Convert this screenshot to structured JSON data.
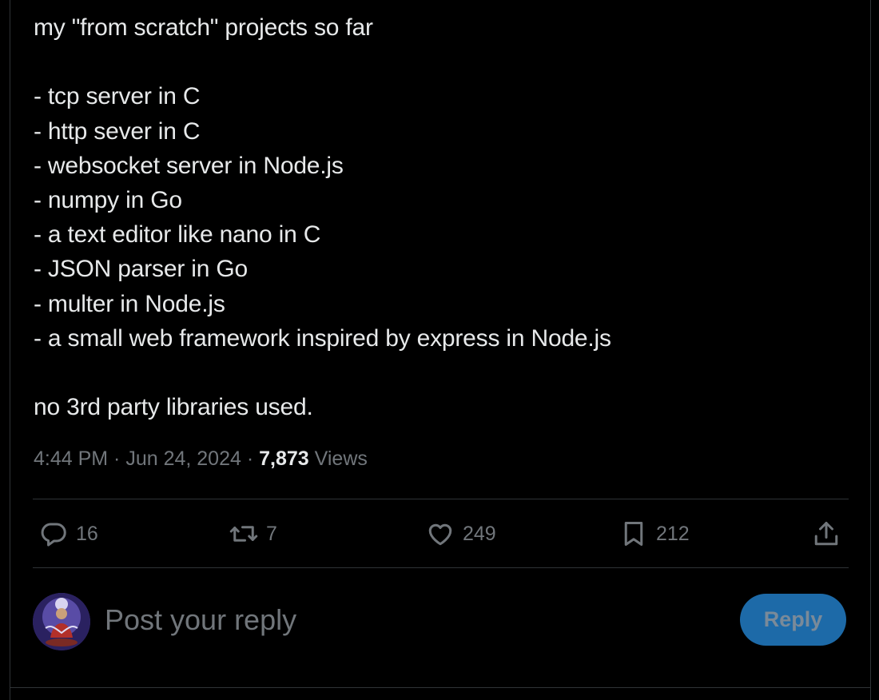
{
  "tweet": {
    "lines": [
      "my \"from scratch\" projects so far",
      "",
      "- tcp server in C",
      "- http sever in C",
      "- websocket server in Node.js",
      "- numpy in Go",
      "- a text editor like nano in C",
      "- JSON parser in Go",
      "- multer in Node.js",
      "- a small web framework inspired by express in Node.js",
      "",
      "no 3rd party libraries used."
    ],
    "time": "4:44 PM",
    "separator": " · ",
    "date": "Jun 24, 2024",
    "views_count": "7,873",
    "views_label": " Views"
  },
  "actions": {
    "reply": {
      "icon": "reply-icon",
      "count": "16"
    },
    "repost": {
      "icon": "repost-icon",
      "count": "7"
    },
    "like": {
      "icon": "heart-icon",
      "count": "249"
    },
    "bookmark": {
      "icon": "bookmark-icon",
      "count": "212"
    },
    "share": {
      "icon": "share-icon"
    }
  },
  "reply_box": {
    "placeholder": "Post your reply",
    "button_label": "Reply"
  },
  "colors": {
    "background": "#000000",
    "text": "#e7e9ea",
    "muted": "#71767b",
    "border": "#2f3336",
    "reply_button": "#1d6aa8"
  }
}
